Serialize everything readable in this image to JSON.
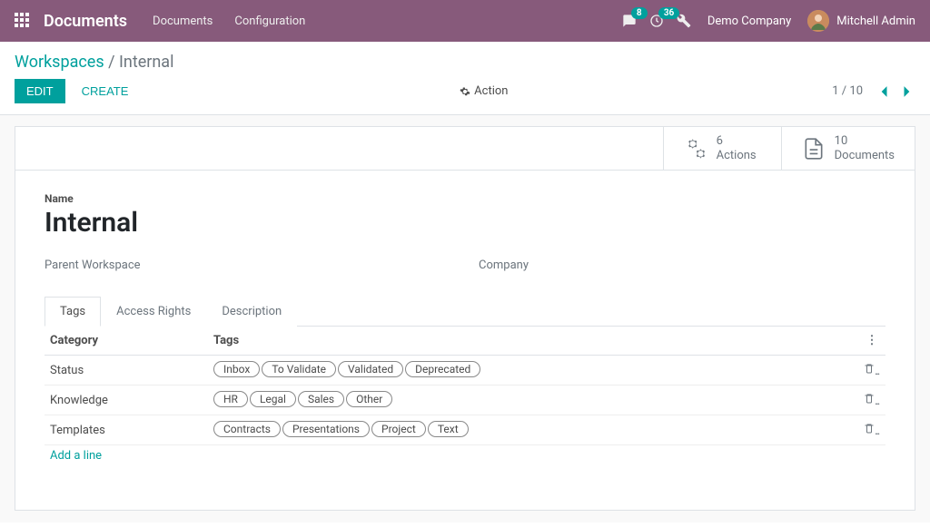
{
  "topnav": {
    "brand": "Documents",
    "links": [
      "Documents",
      "Configuration"
    ],
    "messages_badge": "8",
    "activities_badge": "36",
    "company": "Demo Company",
    "user": "Mitchell Admin"
  },
  "breadcrumb": {
    "root": "Workspaces",
    "sep": " / ",
    "current": "Internal"
  },
  "buttons": {
    "edit": "EDIT",
    "create": "CREATE",
    "action": "Action"
  },
  "pager": {
    "text": "1 / 10"
  },
  "stats": {
    "actions": {
      "count": "6",
      "label": "Actions"
    },
    "documents": {
      "count": "10",
      "label": "Documents"
    }
  },
  "form": {
    "name_label": "Name",
    "name_value": "Internal",
    "parent_label": "Parent Workspace",
    "company_label": "Company"
  },
  "tabs": {
    "tags": "Tags",
    "access": "Access Rights",
    "desc": "Description"
  },
  "table": {
    "col_category": "Category",
    "col_tags": "Tags",
    "rows": [
      {
        "category": "Status",
        "tags": [
          "Inbox",
          "To Validate",
          "Validated",
          "Deprecated"
        ]
      },
      {
        "category": "Knowledge",
        "tags": [
          "HR",
          "Legal",
          "Sales",
          "Other"
        ]
      },
      {
        "category": "Templates",
        "tags": [
          "Contracts",
          "Presentations",
          "Project",
          "Text"
        ]
      }
    ],
    "add_line": "Add a line"
  }
}
